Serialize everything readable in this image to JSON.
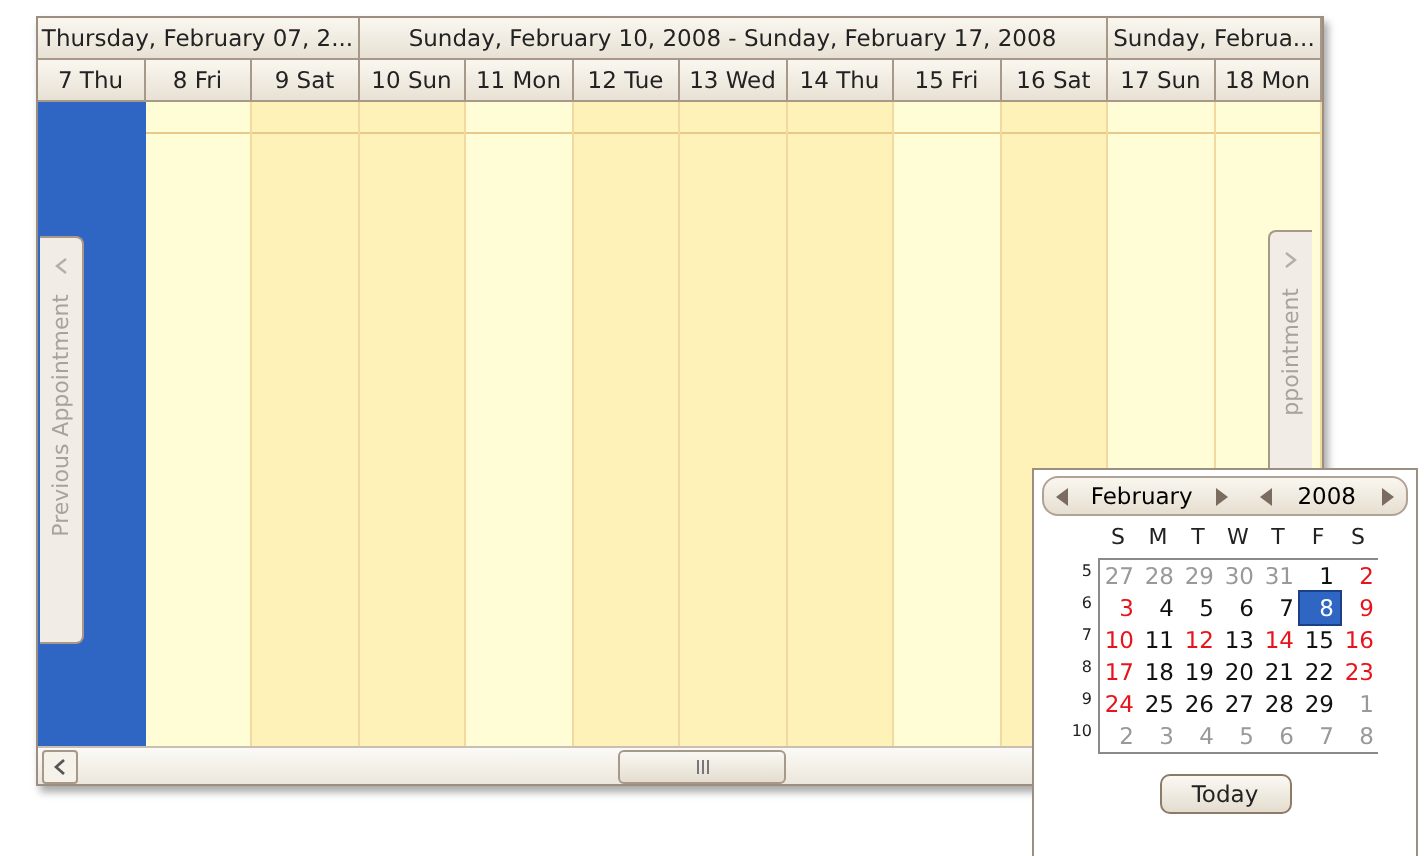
{
  "scheduler": {
    "header_groups": [
      {
        "title": "Thursday, February 07, 2...",
        "days": [
          {
            "label": "7 Thu",
            "selected": true,
            "shaded": false
          },
          {
            "label": "8 Fri",
            "selected": false,
            "shaded": false
          },
          {
            "label": "9 Sat",
            "selected": false,
            "shaded": true
          }
        ]
      },
      {
        "title": "Sunday, February 10, 2008 - Sunday, February 17, 2008",
        "days": [
          {
            "label": "10 Sun",
            "selected": false,
            "shaded": true
          },
          {
            "label": "11 Mon",
            "selected": false,
            "shaded": false
          },
          {
            "label": "12 Tue",
            "selected": false,
            "shaded": true
          },
          {
            "label": "13 Wed",
            "selected": false,
            "shaded": true
          },
          {
            "label": "14 Thu",
            "selected": false,
            "shaded": true
          },
          {
            "label": "15 Fri",
            "selected": false,
            "shaded": false
          },
          {
            "label": "16 Sat",
            "selected": false,
            "shaded": true
          }
        ]
      },
      {
        "title": "Sunday, Februa...",
        "days": [
          {
            "label": "17 Sun",
            "selected": false,
            "shaded": false
          },
          {
            "label": "18 Mon",
            "selected": false,
            "shaded": false
          }
        ]
      }
    ],
    "prev_tab": "Previous Appointment",
    "next_tab": "ppointment"
  },
  "calendar": {
    "month": "February",
    "year": "2008",
    "weekdays": [
      "S",
      "M",
      "T",
      "W",
      "T",
      "F",
      "S"
    ],
    "weeks": [
      {
        "number": "5",
        "days": [
          {
            "d": "27",
            "kind": "other"
          },
          {
            "d": "28",
            "kind": "other"
          },
          {
            "d": "29",
            "kind": "other"
          },
          {
            "d": "30",
            "kind": "other"
          },
          {
            "d": "31",
            "kind": "other"
          },
          {
            "d": "1",
            "kind": "day"
          },
          {
            "d": "2",
            "kind": "weekend"
          }
        ]
      },
      {
        "number": "6",
        "days": [
          {
            "d": "3",
            "kind": "weekend"
          },
          {
            "d": "4",
            "kind": "day"
          },
          {
            "d": "5",
            "kind": "day"
          },
          {
            "d": "6",
            "kind": "day"
          },
          {
            "d": "7",
            "kind": "day"
          },
          {
            "d": "8",
            "kind": "selected"
          },
          {
            "d": "9",
            "kind": "weekend"
          }
        ]
      },
      {
        "number": "7",
        "days": [
          {
            "d": "10",
            "kind": "weekend"
          },
          {
            "d": "11",
            "kind": "day"
          },
          {
            "d": "12",
            "kind": "weekend"
          },
          {
            "d": "13",
            "kind": "day"
          },
          {
            "d": "14",
            "kind": "weekend"
          },
          {
            "d": "15",
            "kind": "day"
          },
          {
            "d": "16",
            "kind": "weekend"
          }
        ]
      },
      {
        "number": "8",
        "days": [
          {
            "d": "17",
            "kind": "weekend"
          },
          {
            "d": "18",
            "kind": "day"
          },
          {
            "d": "19",
            "kind": "day"
          },
          {
            "d": "20",
            "kind": "day"
          },
          {
            "d": "21",
            "kind": "day"
          },
          {
            "d": "22",
            "kind": "day"
          },
          {
            "d": "23",
            "kind": "weekend"
          }
        ]
      },
      {
        "number": "9",
        "days": [
          {
            "d": "24",
            "kind": "weekend"
          },
          {
            "d": "25",
            "kind": "day"
          },
          {
            "d": "26",
            "kind": "day"
          },
          {
            "d": "27",
            "kind": "day"
          },
          {
            "d": "28",
            "kind": "day"
          },
          {
            "d": "29",
            "kind": "day"
          },
          {
            "d": "1",
            "kind": "other"
          }
        ]
      },
      {
        "number": "10",
        "days": [
          {
            "d": "2",
            "kind": "other"
          },
          {
            "d": "3",
            "kind": "other"
          },
          {
            "d": "4",
            "kind": "other"
          },
          {
            "d": "5",
            "kind": "other"
          },
          {
            "d": "6",
            "kind": "other"
          },
          {
            "d": "7",
            "kind": "other"
          },
          {
            "d": "8",
            "kind": "other"
          }
        ]
      }
    ],
    "today_button": "Today"
  }
}
